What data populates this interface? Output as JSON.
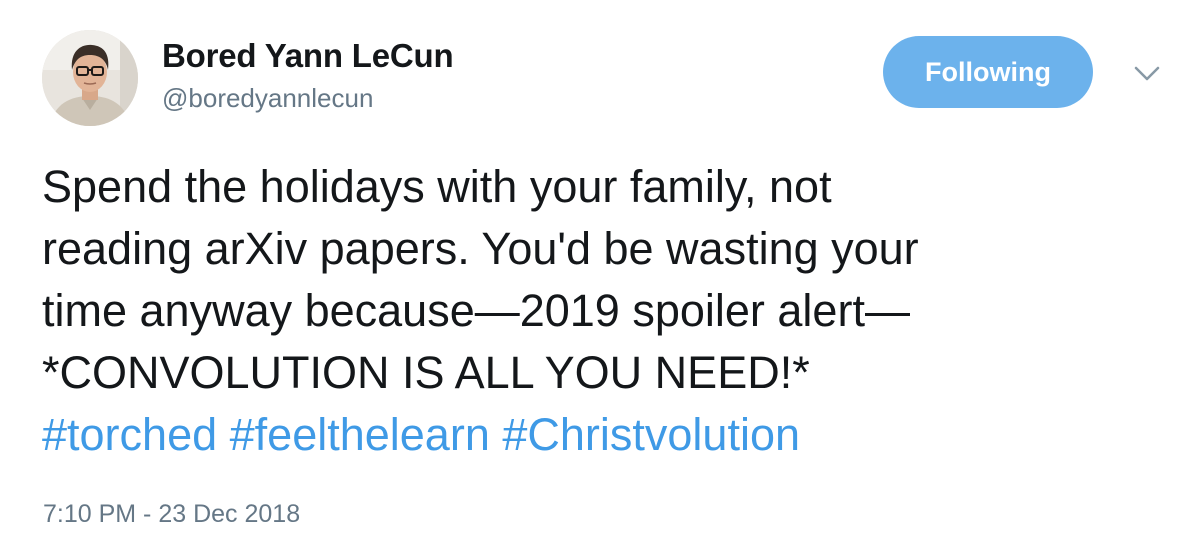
{
  "author": {
    "name": "Bored Yann LeCun",
    "handle": "@boredyannlecun",
    "avatar_icon": "profile-photo"
  },
  "follow_button": {
    "label": "Following",
    "color": "#6cb2ec"
  },
  "more_menu": {
    "icon": "chevron-down-icon"
  },
  "tweet": {
    "lines": [
      "Spend the holidays with your family, not",
      "reading arXiv papers. You'd be wasting your",
      "time anyway because—2019 spoiler alert—",
      "*CONVOLUTION IS ALL YOU NEED!*"
    ],
    "hashtags": [
      "#torched",
      "#feelthelearn",
      "#Christvolution"
    ],
    "hashtag_color": "#3f9ae6"
  },
  "timestamp": "7:10 PM - 23 Dec 2018"
}
